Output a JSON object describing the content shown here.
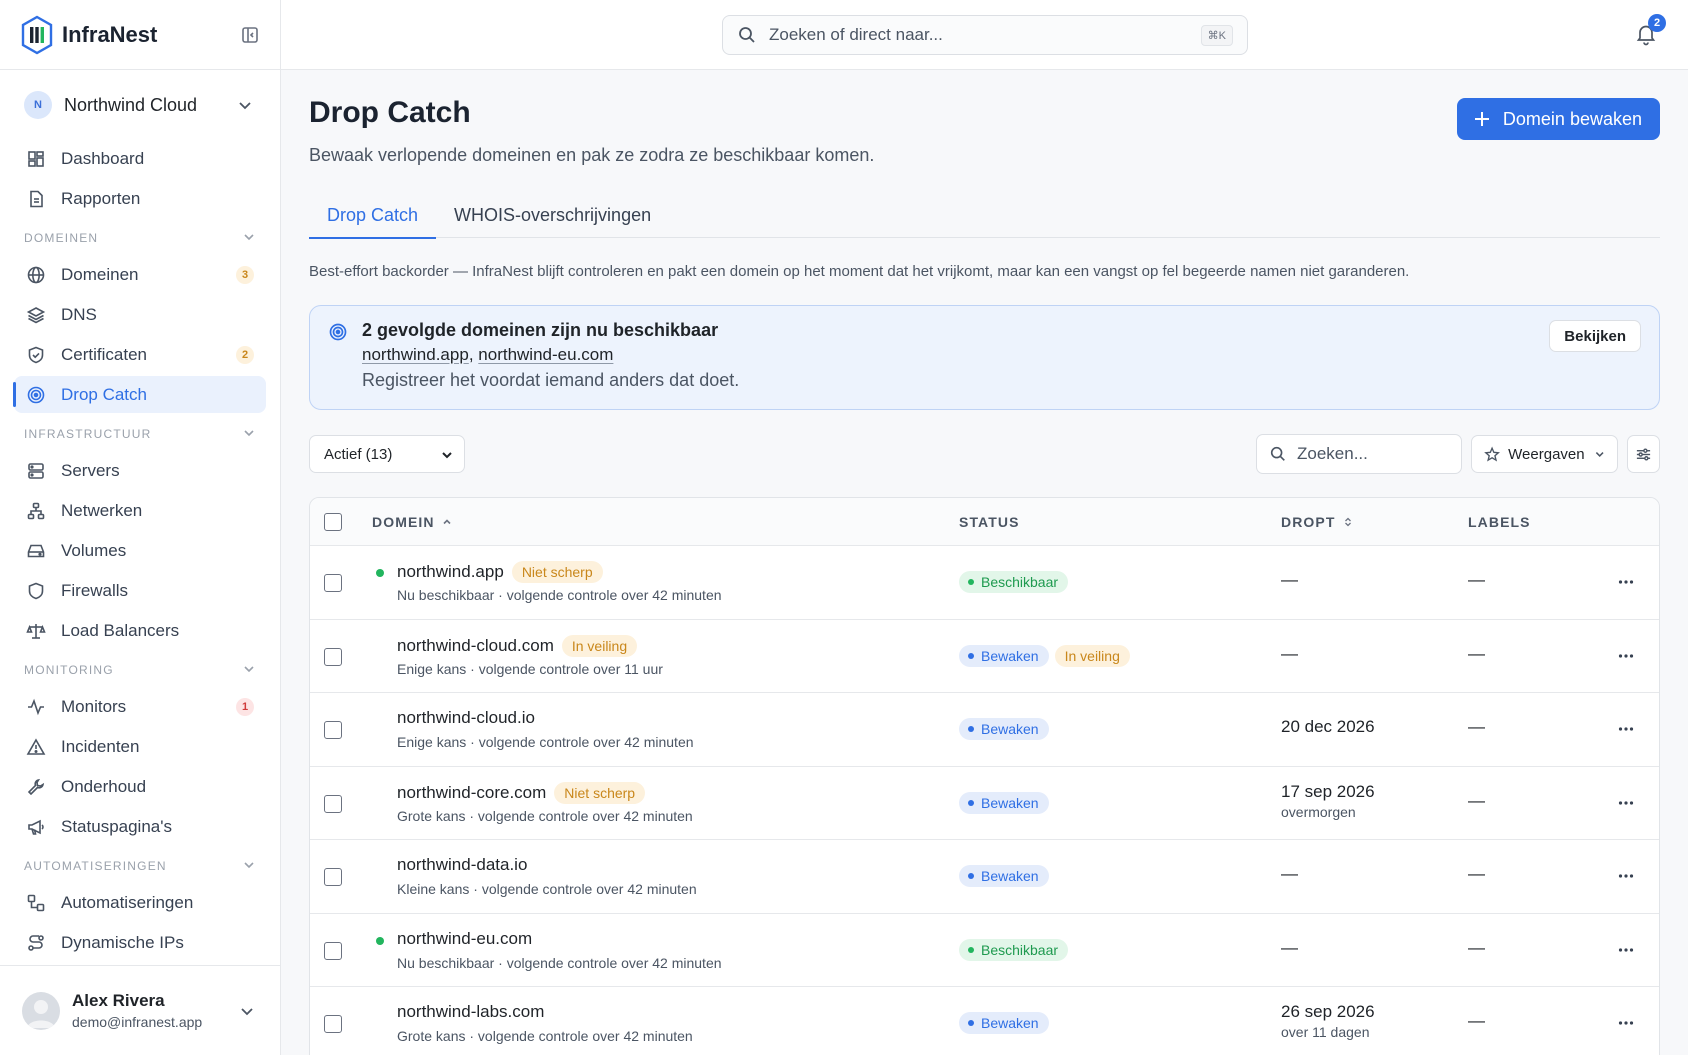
{
  "app": {
    "name": "InfraNest"
  },
  "workspace": {
    "initial": "N",
    "name": "Northwind Cloud"
  },
  "nav": {
    "top": [
      {
        "label": "Dashboard",
        "icon": "dashboard-icon"
      },
      {
        "label": "Rapporten",
        "icon": "report-icon"
      }
    ],
    "sections": [
      {
        "title": "DOMEINEN",
        "items": [
          {
            "label": "Domeinen",
            "badge": "3"
          },
          {
            "label": "DNS"
          },
          {
            "label": "Certificaten",
            "badge": "2"
          },
          {
            "label": "Drop Catch",
            "active": true
          }
        ]
      },
      {
        "title": "INFRASTRUCTUUR",
        "items": [
          {
            "label": "Servers"
          },
          {
            "label": "Netwerken"
          },
          {
            "label": "Volumes"
          },
          {
            "label": "Firewalls"
          },
          {
            "label": "Load Balancers"
          }
        ]
      },
      {
        "title": "MONITORING",
        "items": [
          {
            "label": "Monitors",
            "badge": "1"
          },
          {
            "label": "Incidenten"
          },
          {
            "label": "Onderhoud"
          },
          {
            "label": "Statuspagina's"
          }
        ]
      },
      {
        "title": "AUTOMATISERINGEN",
        "items": [
          {
            "label": "Automatiseringen"
          },
          {
            "label": "Dynamische IPs"
          }
        ]
      }
    ]
  },
  "user": {
    "name": "Alex Rivera",
    "email": "demo@infranest.app"
  },
  "topbar": {
    "search_placeholder": "Zoeken of direct naar...",
    "shortcut": "⌘K",
    "notification_count": "2"
  },
  "page": {
    "title": "Drop Catch",
    "subtitle": "Bewaak verlopende domeinen en pak ze zodra ze beschikbaar komen.",
    "primary_action": "Domein bewaken",
    "tabs": [
      "Drop Catch",
      "WHOIS-overschrijvingen"
    ],
    "note": "Best-effort backorder — InfraNest blijft controleren en pakt een domein op het moment dat het vrijkomt, maar kan een vangst op fel begeerde namen niet garanderen."
  },
  "alert": {
    "title": "2 gevolgde domeinen zijn nu beschikbaar",
    "link1": "northwind.app",
    "separator": ",",
    "link2": "northwind-eu.com",
    "description": "Registreer het voordat iemand anders dat doet.",
    "button": "Bekijken"
  },
  "toolbar": {
    "filter": "Actief (13)",
    "search_placeholder": "Zoeken...",
    "views": "Weergaven"
  },
  "table": {
    "headers": {
      "domain": "DOMEIN",
      "status": "STATUS",
      "drops": "DROPT",
      "labels": "LABELS"
    },
    "rows": [
      {
        "domain": "northwind.app",
        "tag": "Niet scherp",
        "available_dot": true,
        "sub": "Nu beschikbaar · volgende controle over 42 minuten",
        "status": "Beschikbaar",
        "status_type": "green",
        "status_extra": "",
        "drops": "—",
        "drops_sub": "",
        "labels": "—"
      },
      {
        "domain": "northwind-cloud.com",
        "tag": "In veiling",
        "available_dot": false,
        "sub": "Enige kans · volgende controle over 11 uur",
        "status": "Bewaken",
        "status_type": "blue",
        "status_extra": "In veiling",
        "drops": "—",
        "drops_sub": "",
        "labels": "—"
      },
      {
        "domain": "northwind-cloud.io",
        "tag": "",
        "available_dot": false,
        "sub": "Enige kans · volgende controle over 42 minuten",
        "status": "Bewaken",
        "status_type": "blue",
        "status_extra": "",
        "drops": "20 dec 2026",
        "drops_sub": "",
        "labels": "—"
      },
      {
        "domain": "northwind-core.com",
        "tag": "Niet scherp",
        "available_dot": false,
        "sub": "Grote kans · volgende controle over 42 minuten",
        "status": "Bewaken",
        "status_type": "blue",
        "status_extra": "",
        "drops": "17 sep 2026",
        "drops_sub": "overmorgen",
        "labels": "—"
      },
      {
        "domain": "northwind-data.io",
        "tag": "",
        "available_dot": false,
        "sub": "Kleine kans · volgende controle over 42 minuten",
        "status": "Bewaken",
        "status_type": "blue",
        "status_extra": "",
        "drops": "—",
        "drops_sub": "",
        "labels": "—"
      },
      {
        "domain": "northwind-eu.com",
        "tag": "",
        "available_dot": true,
        "sub": "Nu beschikbaar · volgende controle over 42 minuten",
        "status": "Beschikbaar",
        "status_type": "green",
        "status_extra": "",
        "drops": "—",
        "drops_sub": "",
        "labels": "—"
      },
      {
        "domain": "northwind-labs.com",
        "tag": "",
        "available_dot": false,
        "sub": "Grote kans · volgende controle over 42 minuten",
        "status": "Bewaken",
        "status_type": "blue",
        "status_extra": "",
        "drops": "26 sep 2026",
        "drops_sub": "over 11 dagen",
        "labels": "—"
      }
    ]
  },
  "colors": {
    "accent": "#2f6fe4",
    "success": "#22b55e",
    "warning": "#c9871b",
    "danger": "#d03b3b"
  }
}
